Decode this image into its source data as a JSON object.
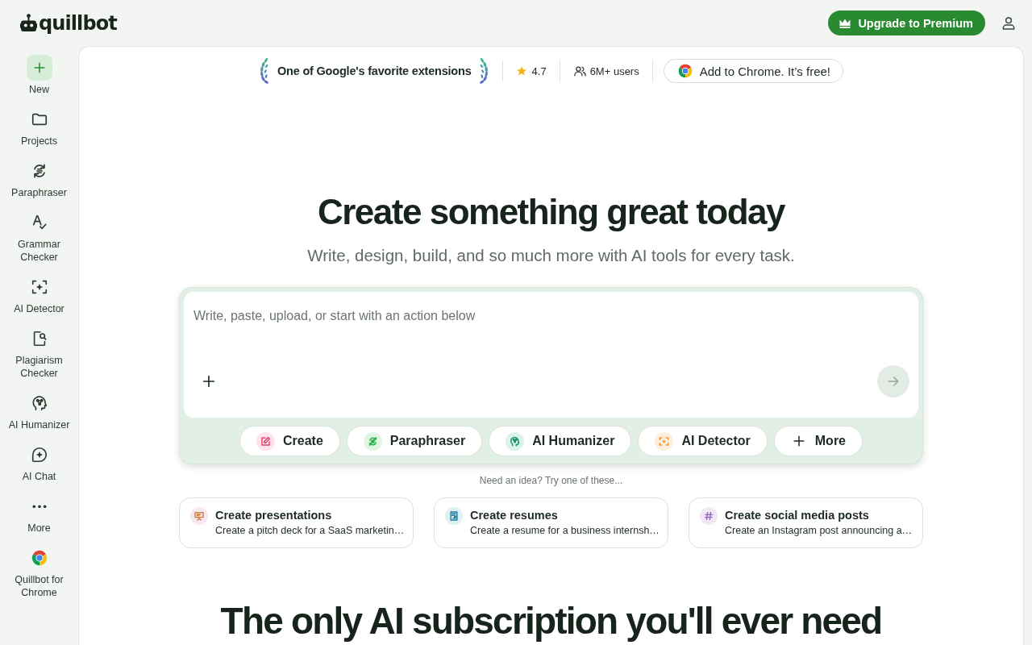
{
  "header": {
    "logo": "quillbot",
    "upgrade_button": "Upgrade to Premium"
  },
  "sidebar": {
    "items": [
      {
        "label": "New",
        "highlighted": true
      },
      {
        "label": "Projects",
        "highlighted": false
      },
      {
        "label": "Paraphraser",
        "highlighted": false
      },
      {
        "label": "Grammar Checker",
        "highlighted": false
      },
      {
        "label": "AI Detector",
        "highlighted": false
      },
      {
        "label": "Plagiarism Checker",
        "highlighted": false
      },
      {
        "label": "AI Humanizer",
        "highlighted": false
      },
      {
        "label": "AI Chat",
        "highlighted": false
      },
      {
        "label": "More",
        "highlighted": false
      },
      {
        "label": "Quillbot for Chrome",
        "highlighted": false
      }
    ]
  },
  "promo_bar": {
    "award": "One of Google's favorite extensions",
    "rating": "4.7",
    "users": "6M+ users",
    "chrome_button": "Add to Chrome. It’s free!"
  },
  "hero": {
    "title": "Create something great today",
    "subtitle": "Write, design, build, and so much more with AI tools for every task."
  },
  "composer": {
    "placeholder": "Write, paste, upload, or start with an action below",
    "actions": [
      {
        "label": "Create"
      },
      {
        "label": "Paraphraser"
      },
      {
        "label": "AI Humanizer"
      },
      {
        "label": "AI Detector"
      },
      {
        "label": "More"
      }
    ]
  },
  "ideas": {
    "hint": "Need an idea? Try one of these...",
    "cards": [
      {
        "title": "Create presentations",
        "description": "Create a pitch deck for a SaaS marketin…"
      },
      {
        "title": "Create resumes",
        "description": "Create a resume for a business internsh…"
      },
      {
        "title": "Create social media posts",
        "description": "Create an Instagram post announcing a…"
      }
    ]
  },
  "section": {
    "title": "The only AI subscription you'll ever need"
  }
}
